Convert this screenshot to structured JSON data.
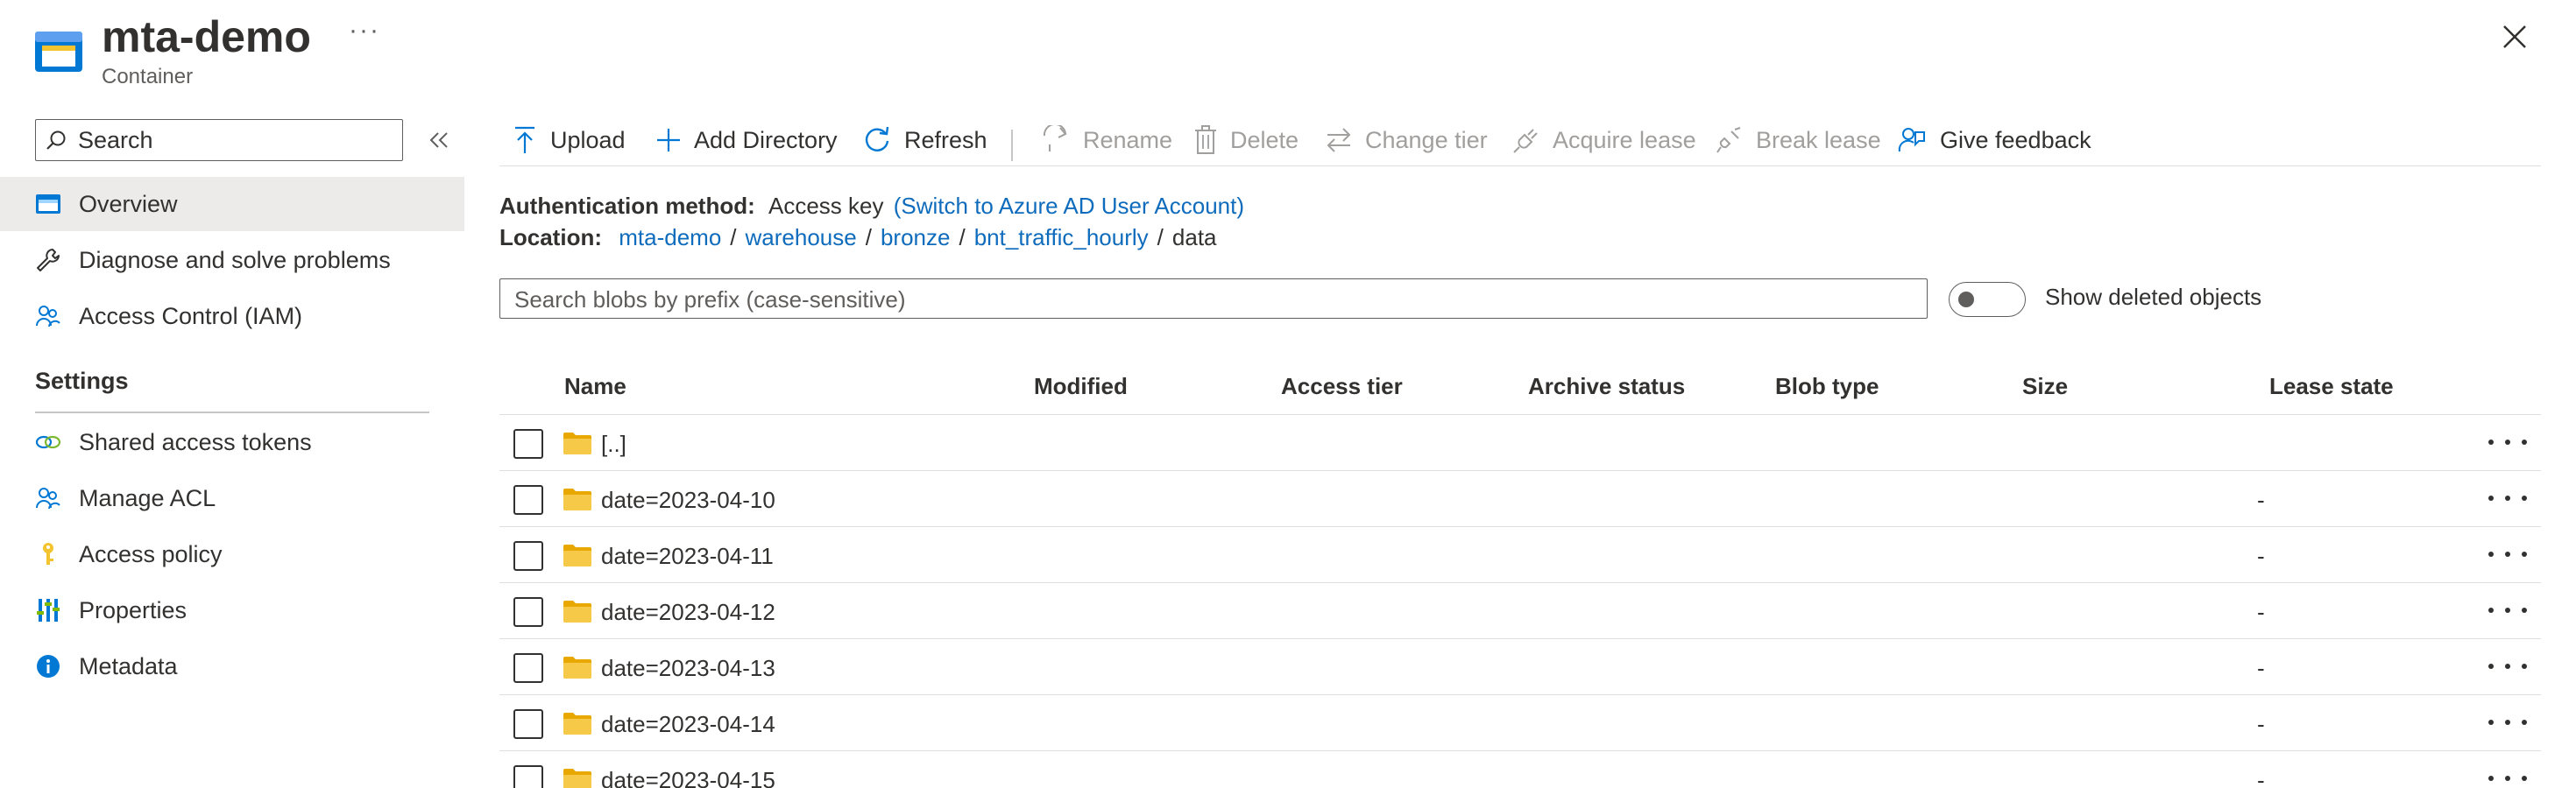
{
  "header": {
    "title": "mta-demo",
    "subtitle": "Container",
    "more_label": "···"
  },
  "sidebar": {
    "search_placeholder": "Search",
    "items": [
      {
        "label": "Overview",
        "icon": "overview-icon"
      },
      {
        "label": "Diagnose and solve problems",
        "icon": "wrench-icon"
      },
      {
        "label": "Access Control (IAM)",
        "icon": "users-icon"
      }
    ],
    "settings_header": "Settings",
    "settings_items": [
      {
        "label": "Shared access tokens",
        "icon": "link-icon"
      },
      {
        "label": "Manage ACL",
        "icon": "users-icon"
      },
      {
        "label": "Access policy",
        "icon": "key-icon"
      },
      {
        "label": "Properties",
        "icon": "sliders-icon"
      },
      {
        "label": "Metadata",
        "icon": "info-icon"
      }
    ]
  },
  "toolbar": {
    "upload": "Upload",
    "add_directory": "Add Directory",
    "refresh": "Refresh",
    "rename": "Rename",
    "delete": "Delete",
    "change_tier": "Change tier",
    "acquire_lease": "Acquire lease",
    "break_lease": "Break lease",
    "give_feedback": "Give feedback"
  },
  "auth": {
    "label": "Authentication method:",
    "value": "Access key",
    "switch_link": "(Switch to Azure AD User Account)"
  },
  "location": {
    "label": "Location:",
    "crumbs": [
      "mta-demo",
      "warehouse",
      "bronze",
      "bnt_traffic_hourly"
    ],
    "current": "data",
    "separator": "/"
  },
  "blob_search": {
    "placeholder": "Search blobs by prefix (case-sensitive)"
  },
  "show_deleted": {
    "label": "Show deleted objects",
    "enabled": false
  },
  "table": {
    "columns": [
      "Name",
      "Modified",
      "Access tier",
      "Archive status",
      "Blob type",
      "Size",
      "Lease state"
    ],
    "rows": [
      {
        "name": "[..]",
        "lease": ""
      },
      {
        "name": "date=2023-04-10",
        "lease": "-"
      },
      {
        "name": "date=2023-04-11",
        "lease": "-"
      },
      {
        "name": "date=2023-04-12",
        "lease": "-"
      },
      {
        "name": "date=2023-04-13",
        "lease": "-"
      },
      {
        "name": "date=2023-04-14",
        "lease": "-"
      },
      {
        "name": "date=2023-04-15",
        "lease": "-"
      }
    ]
  },
  "colors": {
    "accent": "#0f6cbd",
    "folder": "#f4c430",
    "active_bg": "#edebe9"
  }
}
